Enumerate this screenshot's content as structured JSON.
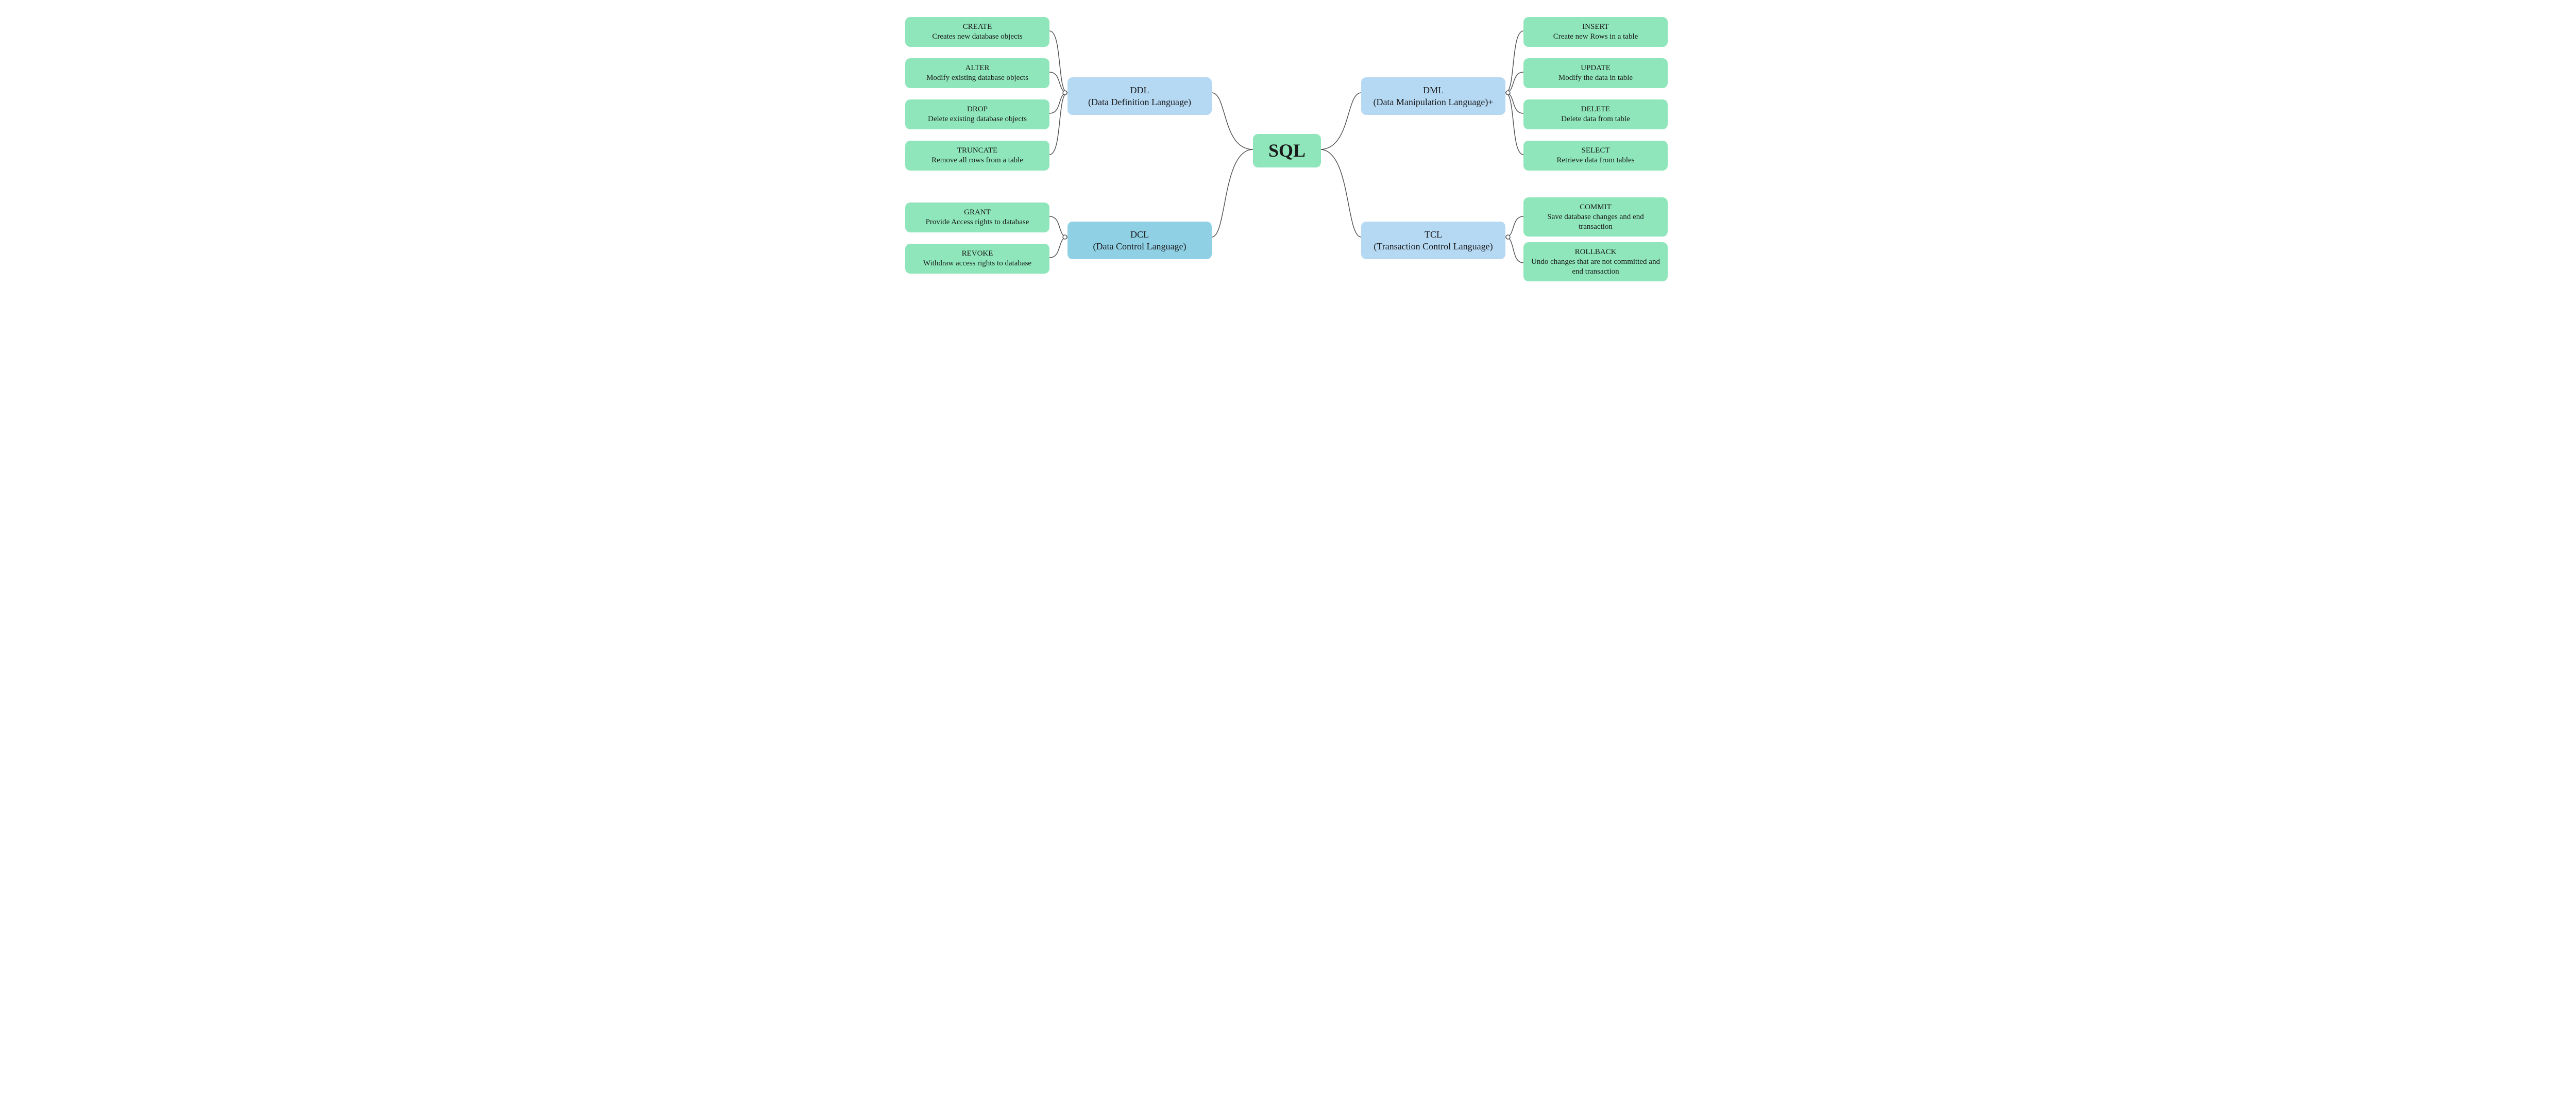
{
  "root": {
    "label": "SQL"
  },
  "categories": {
    "ddl": {
      "line1": "DDL",
      "line2": "(Data Definition Language)"
    },
    "dcl": {
      "line1": "DCL",
      "line2": "(Data Control Language)"
    },
    "dml": {
      "line1": "DML",
      "line2": "(Data Manipulation Language)+"
    },
    "tcl": {
      "line1": "TCL",
      "line2": "(Transaction Control Language)"
    }
  },
  "leaves": {
    "ddl": [
      {
        "line1": "CREATE",
        "line2": "Creates new database objects"
      },
      {
        "line1": "ALTER",
        "line2": "Modify existing database objects"
      },
      {
        "line1": "DROP",
        "line2": "Delete existing database objects"
      },
      {
        "line1": "TRUNCATE",
        "line2": "Remove all rows from a table"
      }
    ],
    "dcl": [
      {
        "line1": "GRANT",
        "line2": "Provide Access rights to database"
      },
      {
        "line1": "REVOKE",
        "line2": "Withdraw access rights to database"
      }
    ],
    "dml": [
      {
        "line1": "INSERT",
        "line2": "Create new Rows in a table"
      },
      {
        "line1": "UPDATE",
        "line2": "Modify the data in table"
      },
      {
        "line1": "DELETE",
        "line2": "Delete data from table"
      },
      {
        "line1": "SELECT",
        "line2": "Retrieve data from tables"
      }
    ],
    "tcl": [
      {
        "line1": "COMMIT",
        "line2": "Save database changes and end transaction"
      },
      {
        "line1": "ROLLBACK",
        "line2": "Undo changes that are not committed and end transaction"
      }
    ]
  }
}
